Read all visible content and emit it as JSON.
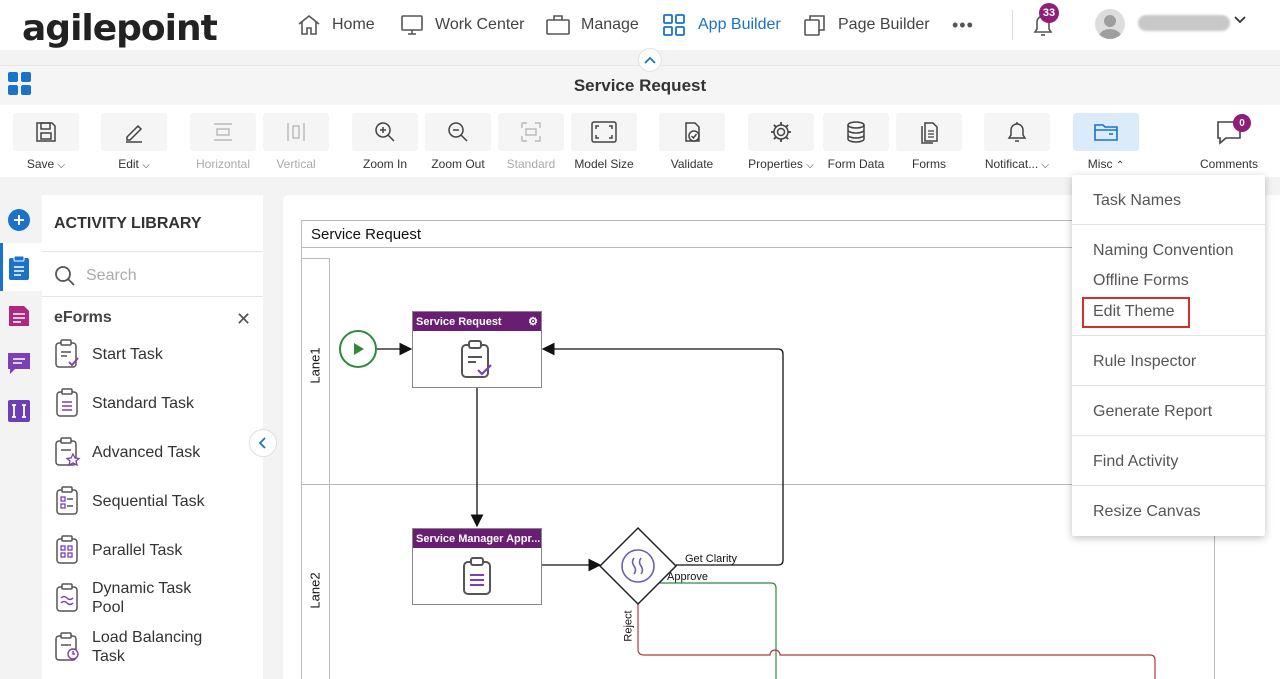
{
  "brand": {
    "logo_text": "agilepoint"
  },
  "nav": {
    "items": [
      {
        "label": "Home",
        "icon": "home-icon"
      },
      {
        "label": "Work Center",
        "icon": "monitor-icon"
      },
      {
        "label": "Manage",
        "icon": "briefcase-icon"
      },
      {
        "label": "App Builder",
        "icon": "apps-grid-icon",
        "active": true
      },
      {
        "label": "Page Builder",
        "icon": "pages-icon"
      }
    ],
    "more_label": "•••",
    "notifications_count": "33"
  },
  "title_bar": {
    "title": "Service Request"
  },
  "toolbar": {
    "items": [
      {
        "label": "Save",
        "dropdown": true,
        "icon": "save-icon"
      },
      {
        "label": "Edit",
        "dropdown": true,
        "icon": "pencil-icon"
      },
      {
        "label": "Horizontal",
        "disabled": true,
        "icon": "horizontal-icon"
      },
      {
        "label": "Vertical",
        "disabled": true,
        "icon": "vertical-icon"
      },
      {
        "label": "Zoom In",
        "icon": "zoom-in-icon"
      },
      {
        "label": "Zoom Out",
        "icon": "zoom-out-icon"
      },
      {
        "label": "Standard",
        "disabled": true,
        "icon": "standard-icon"
      },
      {
        "label": "Model Size",
        "icon": "fit-icon"
      },
      {
        "label": "Validate",
        "icon": "validate-icon"
      },
      {
        "label": "Properties",
        "dropdown": true,
        "icon": "gear-icon"
      },
      {
        "label": "Form Data",
        "icon": "database-icon"
      },
      {
        "label": "Forms",
        "icon": "forms-icon"
      },
      {
        "label": "Notificat...",
        "dropdown": true,
        "icon": "bell-icon"
      },
      {
        "label": "Misc",
        "dropdown": true,
        "expanded": true,
        "icon": "folder-icon"
      },
      {
        "label": "Comments",
        "icon": "comment-icon"
      }
    ],
    "comments_count": "0"
  },
  "library": {
    "title": "ACTIVITY LIBRARY",
    "search_placeholder": "Search",
    "group_label": "eForms",
    "close_label": "✕",
    "items": [
      {
        "label": "Start Task"
      },
      {
        "label": "Standard Task"
      },
      {
        "label": "Advanced Task"
      },
      {
        "label": "Sequential Task"
      },
      {
        "label": "Parallel Task"
      },
      {
        "label": "Dynamic Task\nPool"
      },
      {
        "label": "Load Balancing\nTask"
      }
    ]
  },
  "canvas": {
    "pool_title": "Service Request",
    "lanes": [
      "Lane1",
      "Lane2"
    ],
    "tasks": [
      {
        "title": "Service Request"
      },
      {
        "title": "Service Manager Appr..."
      }
    ],
    "edge_labels": {
      "get_clarity": "Get Clarity",
      "approve": "Approve",
      "reject": "Reject"
    }
  },
  "misc_menu": {
    "items": [
      "Task Names",
      "Naming Convention",
      "Offline Forms",
      "Edit Theme",
      "Rule Inspector",
      "Generate Report",
      "Find Activity",
      "Resize Canvas"
    ],
    "highlighted": "Edit Theme"
  },
  "colors": {
    "accent": "#1a73c9",
    "badge": "#8d1f7a",
    "task_header": "#6a1e73",
    "highlight_border": "#d32f2f"
  }
}
